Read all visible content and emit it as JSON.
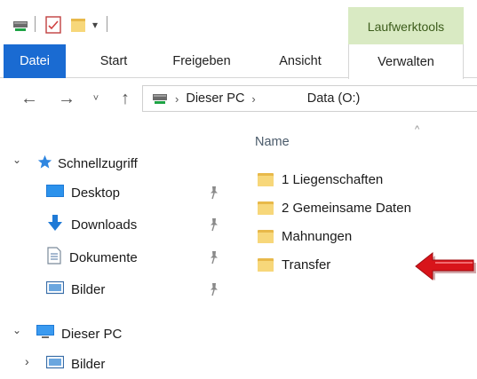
{
  "ribbon": {
    "context_tab_group": "Laufwerktools",
    "tabs": [
      "Datei",
      "Start",
      "Freigeben",
      "Ansicht",
      "Verwalten"
    ]
  },
  "address": {
    "segments": [
      "Dieser PC",
      "Data (O:)"
    ]
  },
  "nav": {
    "quick_access": "Schnellzugriff",
    "items": [
      "Desktop",
      "Downloads",
      "Dokumente",
      "Bilder"
    ],
    "this_pc": "Dieser PC",
    "this_pc_children": [
      "Bilder"
    ]
  },
  "content": {
    "column_header": "Name",
    "folders": [
      "1 Liegenschaften",
      "2 Gemeinsame Daten",
      "Mahnungen",
      "Transfer"
    ]
  },
  "colors": {
    "file_tab": "#1a6bd2",
    "context_tab": "#d9eac3",
    "folder": "#f7d77a",
    "pointer_arrow": "#d8141a"
  }
}
